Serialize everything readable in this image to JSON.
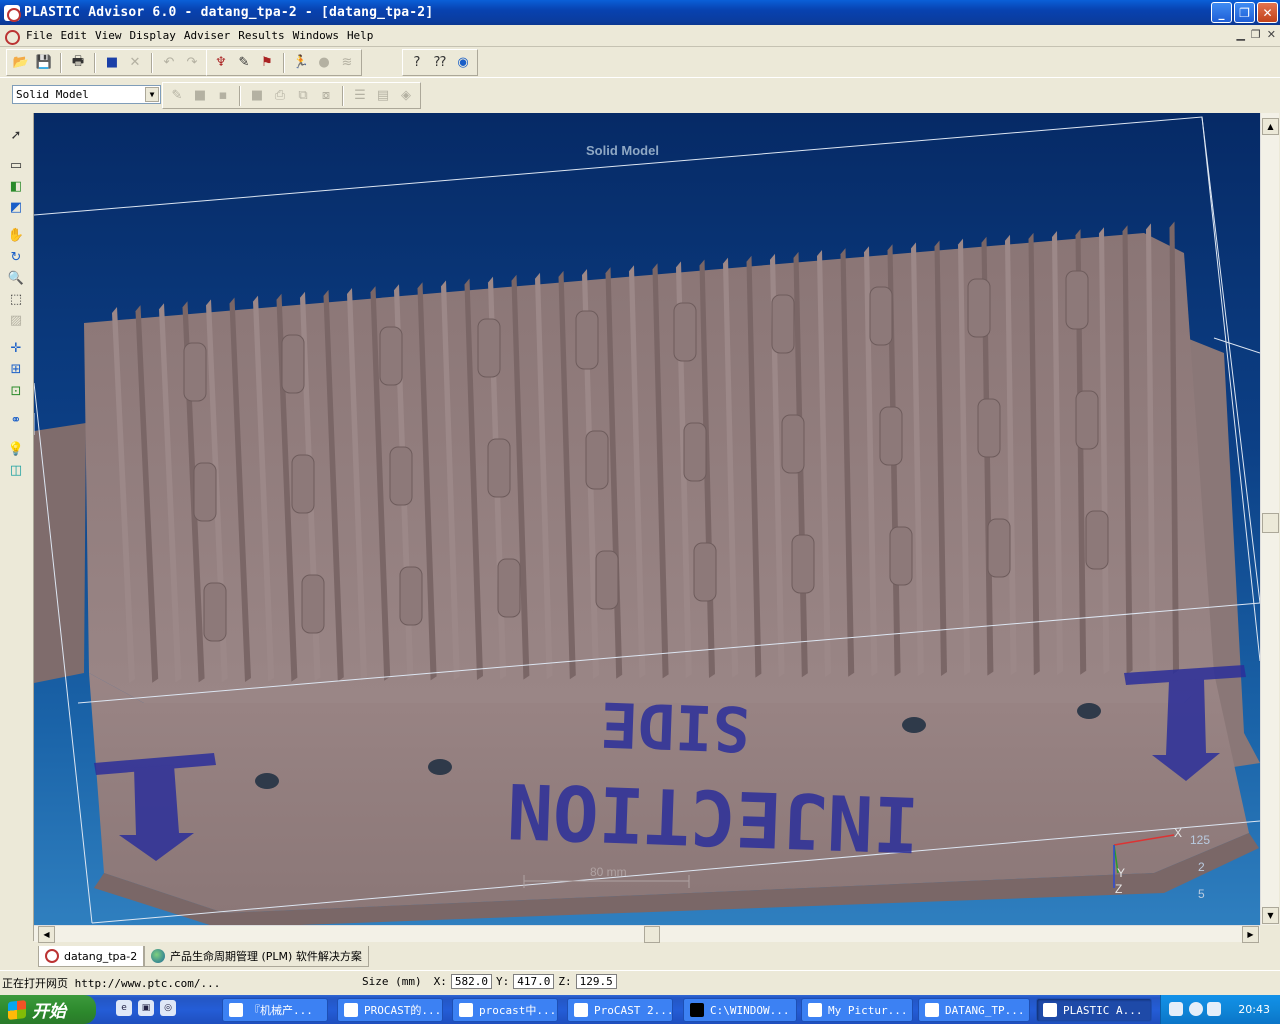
{
  "window": {
    "title": "PLASTIC Advisor 6.0 - datang_tpa-2 - [datang_tpa-2]",
    "controls": [
      "minimize",
      "restore",
      "close"
    ]
  },
  "menu": {
    "items": [
      "File",
      "Edit",
      "View",
      "Display",
      "Adviser",
      "Results",
      "Windows",
      "Help"
    ]
  },
  "toolbar": {
    "display_mode_select": "Solid Model"
  },
  "viewport": {
    "title": "Solid Model",
    "scale_label": "80 mm",
    "axis_labels": {
      "x": "X",
      "y": "Y",
      "z": "Z"
    },
    "axis_numbers": [
      "125",
      "2",
      "5"
    ],
    "part_text": {
      "line1": "SIDE",
      "line2": "INJECTION"
    },
    "colors": {
      "part": "#8f7b7b",
      "background": "#0c3f85",
      "box_outline": "#dde6f2",
      "arrow": "#2c2f9a"
    }
  },
  "doc_tabs": [
    {
      "label": "datang_tpa-2",
      "active": true
    },
    {
      "label": "产品生命周期管理 (PLM) 软件解决方案",
      "active": false
    }
  ],
  "status": {
    "message": "正在打开网页 http://www.ptc.com/...",
    "size_label": "Size (mm)",
    "x_label": "X:",
    "x_value": "582.0",
    "y_label": "Y:",
    "y_value": "417.0",
    "z_label": "Z:",
    "z_value": "129.5"
  },
  "taskbar": {
    "start_label": "开始",
    "tasks": [
      {
        "label": "『机械产...",
        "active": false
      },
      {
        "label": "PROCAST的...",
        "active": false
      },
      {
        "label": "procast中...",
        "active": false
      },
      {
        "label": "ProCAST 2...",
        "active": false
      },
      {
        "label": "C:\\WINDOW...",
        "active": false
      },
      {
        "label": "My Pictur...",
        "active": false
      },
      {
        "label": "DATANG_TP...",
        "active": false
      },
      {
        "label": "PLASTIC A...",
        "active": true
      }
    ],
    "clock": "20:43"
  }
}
